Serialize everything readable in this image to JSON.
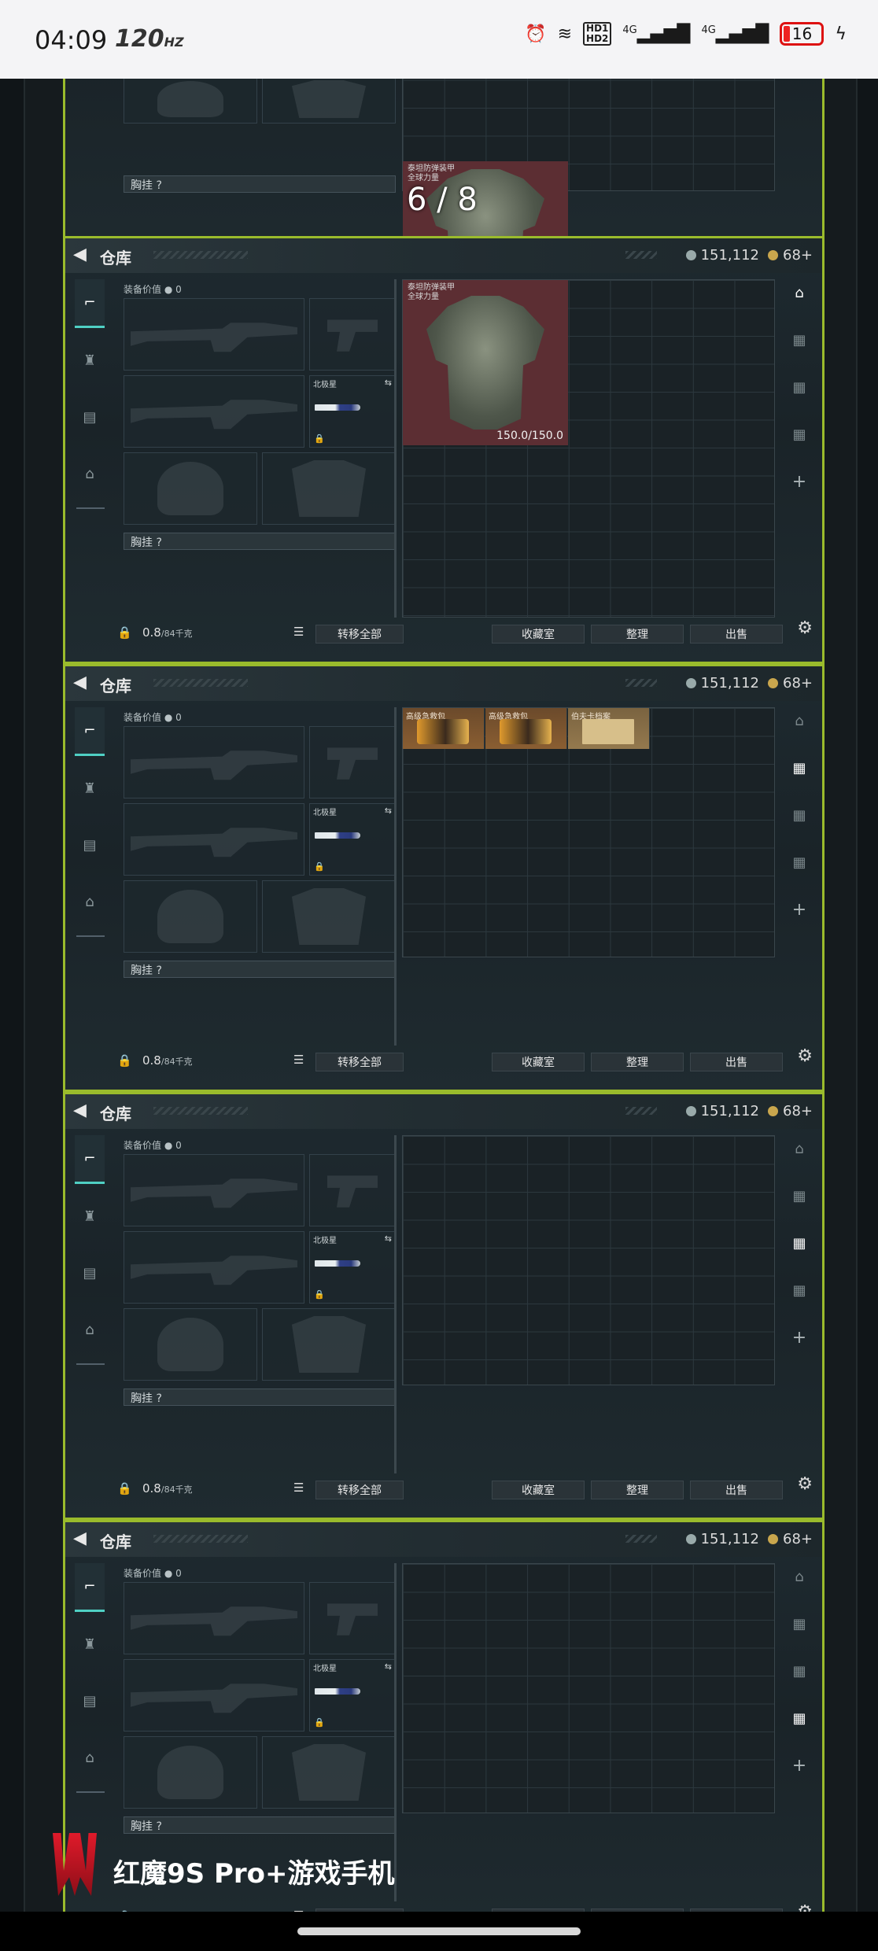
{
  "status": {
    "time": "04:09",
    "refresh": "120",
    "refresh_unit": "HZ",
    "net1": "4G",
    "net2": "4G",
    "battery": "16",
    "hd1": "HD1",
    "hd2": "HD2"
  },
  "warehouse": {
    "title": "仓库",
    "currency": "151,112",
    "bonds": "68+",
    "equip_value_label": "装备价值",
    "equip_value": "0",
    "knife_name": "北极星",
    "chest_label": "胸挂 ?",
    "weight": "0.8",
    "weight_cap": "/84千克",
    "transfer_all": "转移全部",
    "collection": "收藏室",
    "sort": "整理",
    "sell": "出售"
  },
  "top_panel": {
    "counter": "6 / 8",
    "armor_label": "泰坦防弹装甲\n全球力量"
  },
  "panel1": {
    "armor_label": "泰坦防弹装甲\n全球力量",
    "armor_durability": "150.0/150.0"
  },
  "panel2": {
    "items": [
      "高级急救包",
      "高级急救包",
      "伯夫卡档案"
    ]
  },
  "watermark": "红魔9S Pro+游戏手机"
}
